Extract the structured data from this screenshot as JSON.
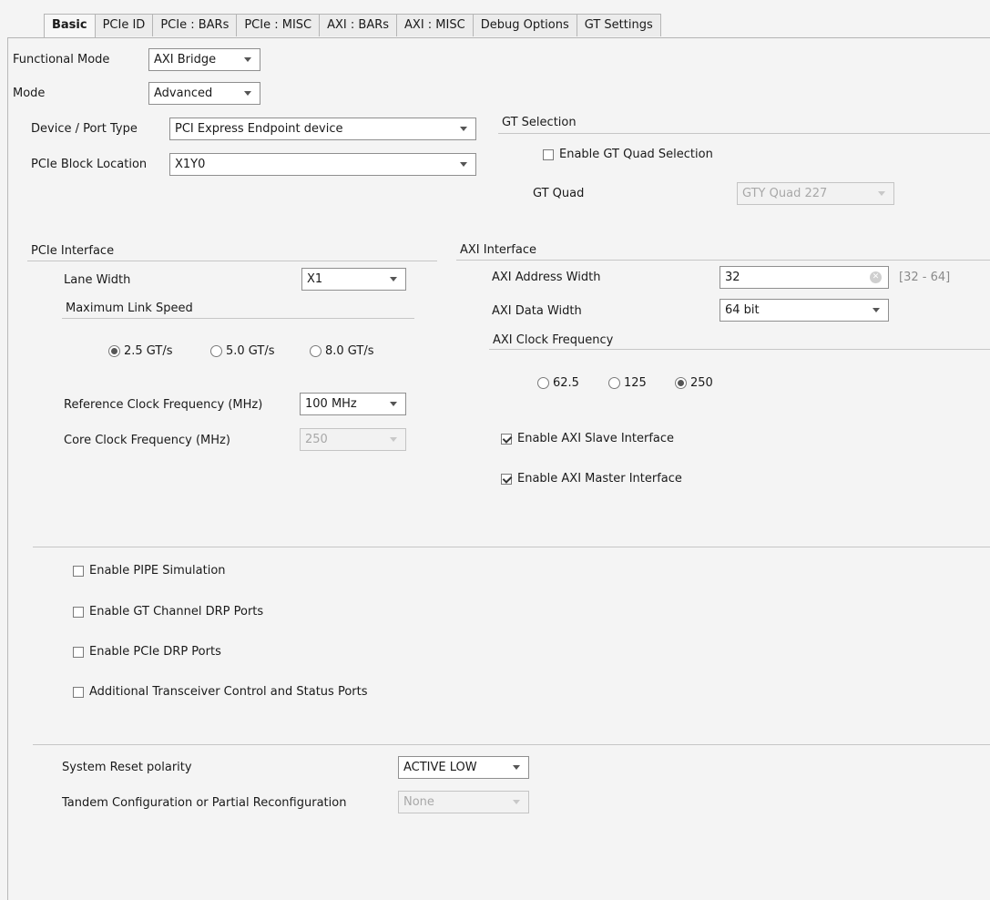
{
  "tabs": [
    "Basic",
    "PCIe ID",
    "PCIe : BARs",
    "PCIe : MISC",
    "AXI : BARs",
    "AXI : MISC",
    "Debug Options",
    "GT Settings"
  ],
  "basic": {
    "functional_mode": {
      "label": "Functional Mode",
      "value": "AXI Bridge"
    },
    "mode": {
      "label": "Mode",
      "value": "Advanced"
    },
    "device_port_type": {
      "label": "Device / Port Type",
      "value": "PCI Express Endpoint device"
    },
    "block_location": {
      "label": "PCIe Block Location",
      "value": "X1Y0"
    }
  },
  "gt_selection": {
    "title": "GT Selection",
    "enable_quad": {
      "label": "Enable GT Quad Selection",
      "checked": false
    },
    "quad": {
      "label": "GT Quad",
      "value": "GTY Quad 227",
      "enabled": false
    }
  },
  "pcie_interface": {
    "title": "PCIe Interface",
    "lane_width": {
      "label": "Lane Width",
      "value": "X1"
    },
    "max_link_speed": {
      "title": "Maximum Link Speed",
      "options": [
        "2.5 GT/s",
        "5.0 GT/s",
        "8.0 GT/s"
      ],
      "selected": "2.5 GT/s"
    },
    "ref_clock": {
      "label": "Reference Clock Frequency (MHz)",
      "value": "100 MHz"
    },
    "core_clock": {
      "label": "Core Clock Frequency (MHz)",
      "value": "250",
      "enabled": false
    }
  },
  "axi_interface": {
    "title": "AXI Interface",
    "address_width": {
      "label": "AXI Address Width",
      "value": "32",
      "range": "[32 - 64]"
    },
    "data_width": {
      "label": "AXI Data Width",
      "value": "64 bit"
    },
    "clock_freq": {
      "title": "AXI Clock Frequency",
      "options": [
        "62.5",
        "125",
        "250"
      ],
      "selected": "250"
    },
    "slave": {
      "label": "Enable AXI Slave Interface",
      "checked": true
    },
    "master": {
      "label": "Enable AXI Master Interface",
      "checked": true
    }
  },
  "options": {
    "pipe_sim": {
      "label": "Enable PIPE Simulation",
      "checked": false
    },
    "gt_drp": {
      "label": "Enable GT Channel DRP Ports",
      "checked": false
    },
    "pcie_drp": {
      "label": "Enable PCIe DRP Ports",
      "checked": false
    },
    "transceiver": {
      "label": "Additional Transceiver Control and Status Ports",
      "checked": false
    }
  },
  "reset": {
    "polarity": {
      "label": "System Reset polarity",
      "value": "ACTIVE LOW"
    },
    "tandem": {
      "label": "Tandem Configuration or Partial Reconfiguration",
      "value": "None",
      "enabled": false
    }
  }
}
